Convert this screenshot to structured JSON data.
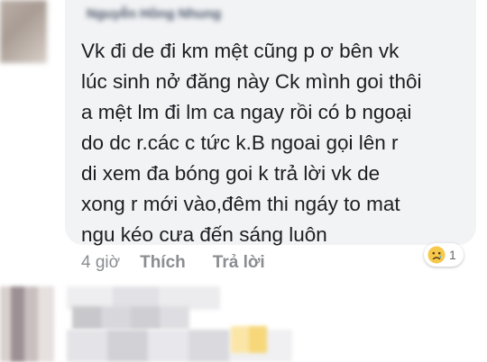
{
  "comment": {
    "author": "Nguyễn Hồng Nhung",
    "lines": [
      "Vk đi de đi km mệt cũng p ơ bên vk",
      "lúc sinh nở đăng này Ck mình goi thôi",
      "a mệt lm đi lm ca ngay rồi có b ngoại",
      "do dc r.các c tức k.B ngoai gọi lên  r",
      "di xem đa bóng goi k trả lời vk de",
      "xong r mới vào,đêm thi ngáy to mat",
      "ngu kéo cưa đến sáng luôn"
    ],
    "reaction": {
      "icon": "sad-face-icon",
      "count": "1"
    },
    "actions": {
      "time": "4 giờ",
      "like": "Thích",
      "reply": "Trả lời"
    }
  },
  "colors": {
    "bubble": "#f2f3f5",
    "text": "#1c1e21",
    "meta": "#8a8d91"
  }
}
